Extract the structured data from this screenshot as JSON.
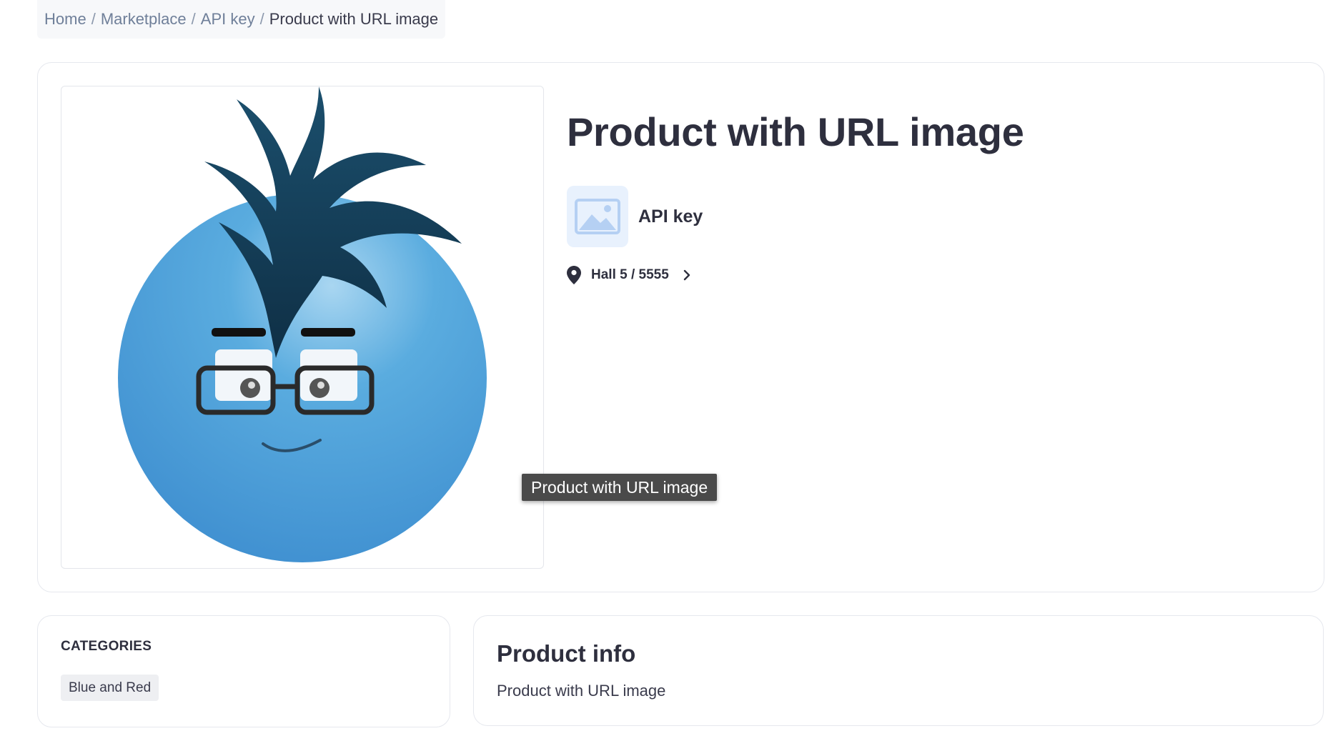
{
  "breadcrumb": {
    "items": [
      "Home",
      "Marketplace",
      "API key"
    ],
    "separator": "/",
    "current": "Product with URL image"
  },
  "product": {
    "title": "Product with URL image",
    "image_icon": "blue-cartoon-face-with-glasses",
    "tooltip": "Product with URL image"
  },
  "vendor": {
    "name": "API key",
    "logo_icon": "image-placeholder-icon"
  },
  "location": {
    "text": "Hall 5 / 5555",
    "icon": "map-pin-icon"
  },
  "categories": {
    "heading": "CATEGORIES",
    "items": [
      "Blue and Red"
    ]
  },
  "info": {
    "heading": "Product info",
    "description": "Product with URL image"
  },
  "colors": {
    "text": "#2e2f3e",
    "link": "#6f7f99",
    "border": "#e6e8ee",
    "chip_bg": "#eeeff2",
    "tooltip_bg": "#4a4a4a",
    "placeholder_bg": "#e8f1fd"
  }
}
